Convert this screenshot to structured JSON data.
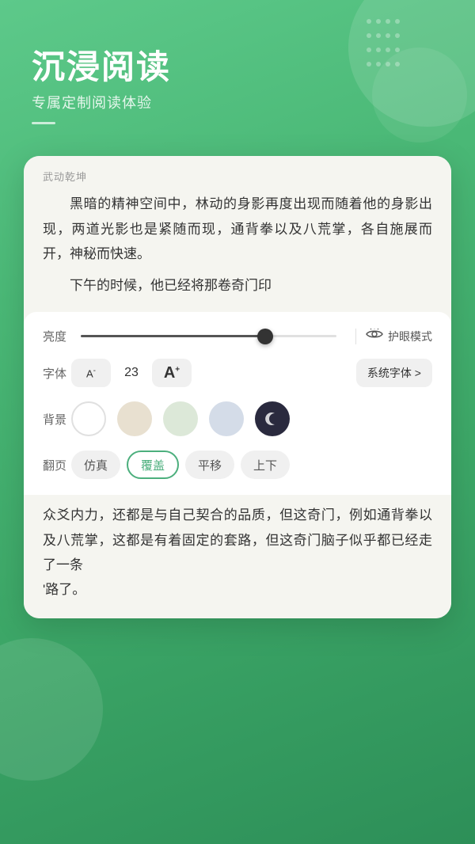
{
  "header": {
    "title": "沉浸阅读",
    "subtitle": "专属定制阅读体验"
  },
  "book": {
    "title": "武动乾坤",
    "paragraphs": [
      "黑暗的精神空间中，林动的身影再度出现而随着他的身影出现，两道光影也是紧随而现，通背拳以及八荒掌，各自施展而开，神秘而快速。",
      "下午的时候，他已经将那卷奇门印"
    ],
    "bottom_paragraphs": [
      "众爻内力，还都是与自己契合的品质，但这奇门，例如通背拳以及八荒掌，这都是有着固定的套路，但这奇门脑子似乎都已经走了一条路了。"
    ]
  },
  "settings": {
    "brightness_label": "亮度",
    "brightness_value": 72,
    "eye_mode_label": "护眼模式",
    "font_label": "字体",
    "font_size": "23",
    "font_decrease": "A⁻",
    "font_increase": "A⁺",
    "font_family": "系统字体 >",
    "background_label": "背景",
    "backgrounds": [
      "white",
      "beige",
      "light-green",
      "light-blue",
      "dark"
    ],
    "selected_background": "white",
    "page_label": "翻页",
    "page_options": [
      "仿真",
      "覆盖",
      "平移",
      "上下"
    ],
    "selected_page": "覆盖"
  }
}
